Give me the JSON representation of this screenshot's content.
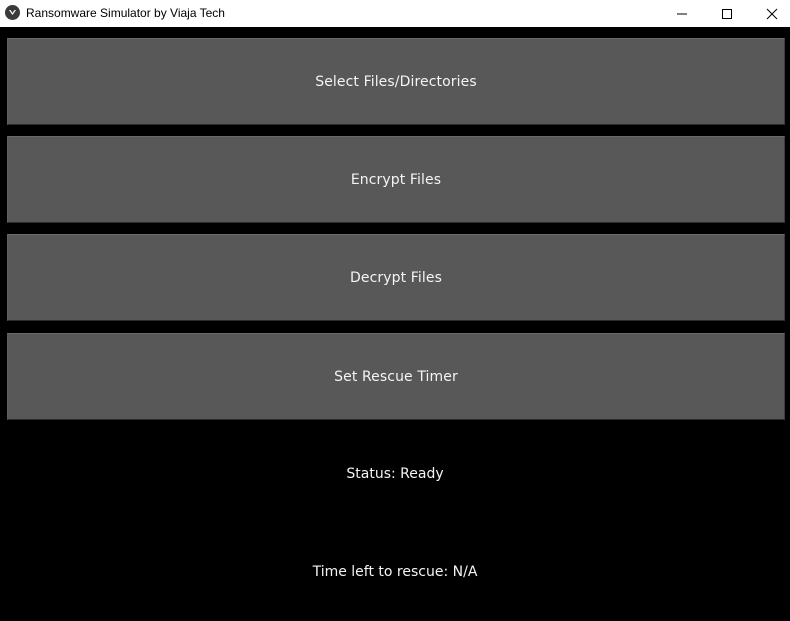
{
  "window": {
    "title": "Ransomware Simulator by Viaja Tech",
    "icon": "app-logo-icon",
    "controls": [
      "minimize-icon",
      "maximize-icon",
      "close-icon"
    ]
  },
  "buttons": {
    "select": "Select Files/Directories",
    "encrypt": "Encrypt Files",
    "decrypt": "Decrypt Files",
    "timer": "Set Rescue Timer"
  },
  "status": {
    "text": "Status: Ready"
  },
  "rescue": {
    "text": "Time left to rescue: N/A"
  },
  "colors": {
    "background": "#000000",
    "button": "#585858",
    "text": "#f4f4f4",
    "titlebar": "#ffffff"
  }
}
